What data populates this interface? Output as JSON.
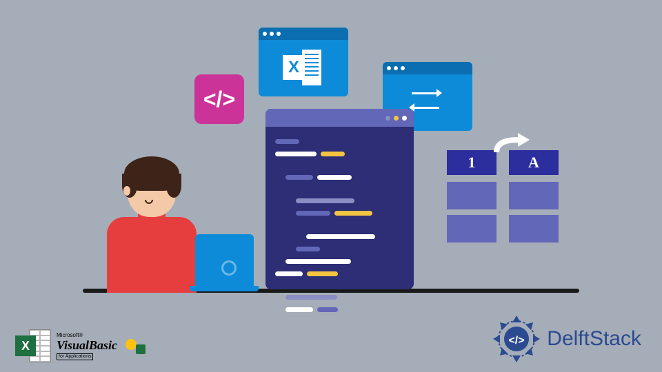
{
  "icons": {
    "code_tag": "</>",
    "excel_x": "X",
    "excel_app_x": "X"
  },
  "table": {
    "header_1": "1",
    "header_a": "A"
  },
  "vba": {
    "microsoft": "Microsoft®",
    "visual_basic": "VisualBasic",
    "for_apps": "for Applications"
  },
  "brand": {
    "name": "DelftStack"
  }
}
